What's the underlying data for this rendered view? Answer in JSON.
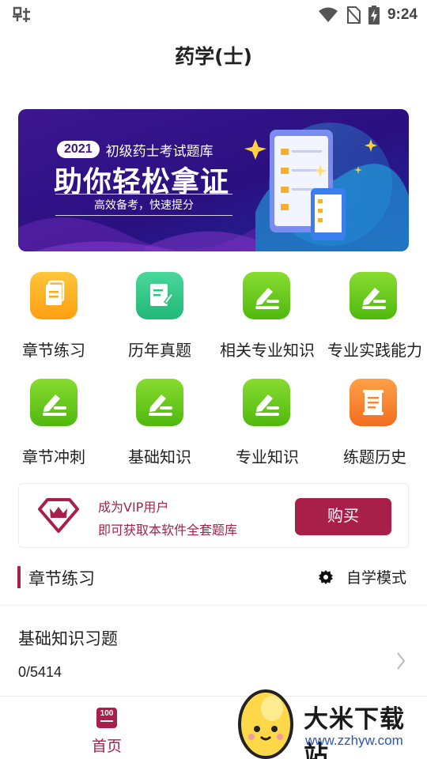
{
  "status_bar": {
    "time": "9:24"
  },
  "header": {
    "title": "药学(士)"
  },
  "banner": {
    "year": "2021",
    "subtitle": "初级药士考试题库",
    "headline": "助你轻松拿证",
    "tagline": "高效备考，快速提分"
  },
  "grid": [
    {
      "label": "章节练习",
      "icon": "document-icon",
      "color": "#ffb020"
    },
    {
      "label": "历年真题",
      "icon": "paper-pen-icon",
      "color": "#38c98a"
    },
    {
      "label": "相关专业知识",
      "icon": "pencil-icon",
      "color": "#64c820"
    },
    {
      "label": "专业实践能力",
      "icon": "pencil-icon",
      "color": "#64c820"
    },
    {
      "label": "章节冲刺",
      "icon": "pencil-icon",
      "color": "#64c820"
    },
    {
      "label": "基础知识",
      "icon": "pencil-icon",
      "color": "#64c820"
    },
    {
      "label": "专业知识",
      "icon": "pencil-icon",
      "color": "#64c820"
    },
    {
      "label": "练题历史",
      "icon": "scroll-icon",
      "color": "#f68a30"
    }
  ],
  "vip": {
    "line1": "成为VIP用户",
    "line2": "即可获取本软件全套题库",
    "buy_label": "购买",
    "accent": "#a8204a"
  },
  "section": {
    "title": "章节练习",
    "mode_label": "自学模式"
  },
  "exercise": {
    "title": "基础知识习题",
    "progress": "0/5414"
  },
  "bottom_nav": {
    "home_icon_text": "100",
    "home_label": "首页"
  },
  "watermark": {
    "name": "大米下载站",
    "url": "www.zzhyw.com"
  }
}
